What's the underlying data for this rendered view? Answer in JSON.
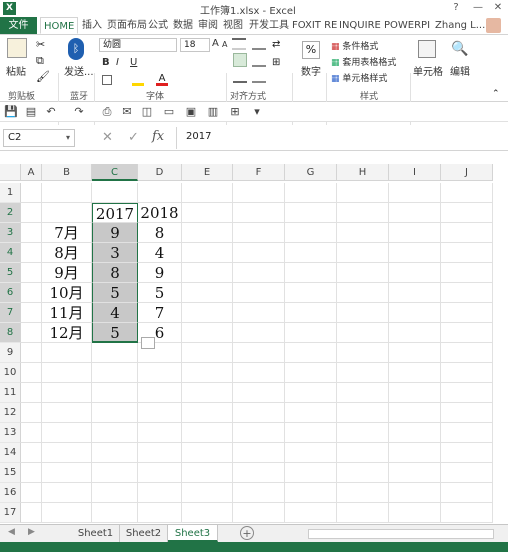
{
  "window": {
    "title": "工作簿1.xlsx - Excel",
    "help_label": "?",
    "minimize_label": "—",
    "close_label": "✕",
    "app_icon": "X"
  },
  "ribbon_tabs": [
    "文件",
    "HOME",
    "插入",
    "页面布局",
    "公式",
    "数据",
    "审阅",
    "视图",
    "开发工具",
    "FOXIT RE",
    "INQUIRE",
    "POWERPI"
  ],
  "user_name": "Zhang L...",
  "ribbon": {
    "clipboard": {
      "paste_label": "粘贴",
      "group_label": "剪贴板"
    },
    "bluetooth": {
      "send_label": "发送...",
      "group_label": "蓝牙"
    },
    "font": {
      "font_name": "幼圆",
      "font_size": "18",
      "bold": "B",
      "italic": "I",
      "underline": "U",
      "group_label": "字体",
      "grow": "A",
      "shrink": "A"
    },
    "alignment": {
      "group_label": "对齐方式"
    },
    "number": {
      "label": "数字"
    },
    "styles": {
      "conditional": "条件格式",
      "table": "套用表格格式",
      "cell_styles": "单元格样式",
      "group_label": "样式"
    },
    "cells": {
      "label": "单元格"
    },
    "editing": {
      "label": "编辑"
    }
  },
  "formula_bar": {
    "name_box": "C2",
    "cancel": "✕",
    "enter": "✓",
    "fx": "fx",
    "value": "2017"
  },
  "columns": [
    "A",
    "B",
    "C",
    "D",
    "E",
    "F",
    "G",
    "H",
    "I",
    "J"
  ],
  "rows": [
    "1",
    "2",
    "3",
    "4",
    "5",
    "6",
    "7",
    "8",
    "9",
    "10",
    "11",
    "12",
    "13",
    "14",
    "15",
    "16",
    "17"
  ],
  "cells": {
    "C2": "2017",
    "D2": "2018",
    "B3": "7月",
    "C3": "9",
    "D3": "8",
    "B4": "8月",
    "C4": "3",
    "D4": "4",
    "B5": "9月",
    "C5": "8",
    "D5": "9",
    "B6": "10月",
    "C6": "5",
    "D6": "5",
    "B7": "11月",
    "C7": "4",
    "D7": "7",
    "B8": "12月",
    "C8": "5",
    "D8": "6"
  },
  "sheets": [
    "Sheet1",
    "Sheet2",
    "Sheet3"
  ],
  "add_sheet": "+",
  "accent": "#217346"
}
